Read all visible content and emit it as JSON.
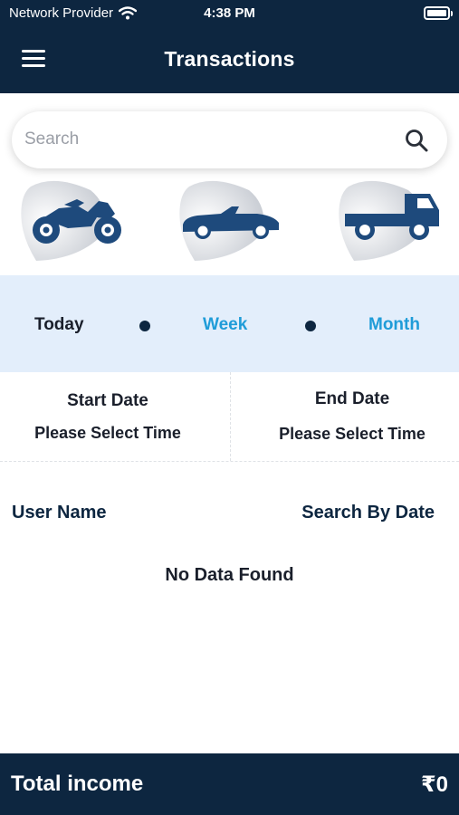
{
  "status_bar": {
    "carrier": "Network Provider",
    "time": "4:38 PM",
    "wifi_icon": "wifi-icon",
    "battery_icon": "battery-icon"
  },
  "header": {
    "title": "Transactions",
    "menu_icon": "hamburger-menu-icon"
  },
  "search": {
    "placeholder": "Search",
    "value": "",
    "icon": "search-icon"
  },
  "vehicle_types": [
    {
      "name": "motorcycle",
      "icon": "motorcycle-icon"
    },
    {
      "name": "car",
      "icon": "car-icon"
    },
    {
      "name": "truck",
      "icon": "truck-icon"
    }
  ],
  "period_filter": {
    "options": [
      "Today",
      "Week",
      "Month"
    ],
    "selected": "Today"
  },
  "date_range": {
    "start_label": "Start Date",
    "start_value": "Please Select Time",
    "end_label": "End Date",
    "end_value": "Please Select Time"
  },
  "filters": {
    "user_name": "User Name",
    "search_by_date": "Search By Date"
  },
  "results": {
    "empty_message": "No Data Found"
  },
  "footer": {
    "label": "Total income",
    "amount": "₹0"
  },
  "colors": {
    "primary": "#0d2640",
    "accent": "#1f9cd8",
    "period_bg": "#e3eefb",
    "icon_color": "#1e4a7c"
  }
}
